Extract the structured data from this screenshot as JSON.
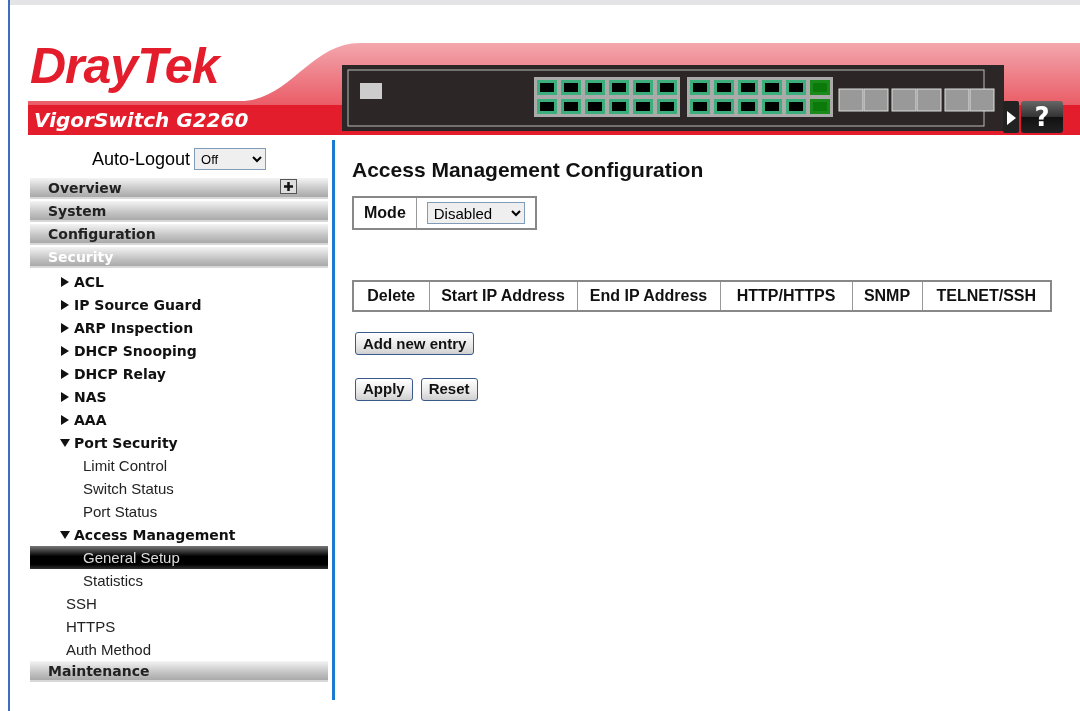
{
  "header": {
    "logo": "DrayTek",
    "model": "VigorSwitch G2260",
    "help_button": "?"
  },
  "sidebar": {
    "auto_logout": {
      "label": "Auto-Logout",
      "value": "Off"
    },
    "sections": [
      {
        "label": "Overview",
        "selected": false
      },
      {
        "label": "System",
        "selected": false
      },
      {
        "label": "Configuration",
        "selected": false
      },
      {
        "label": "Security",
        "selected": true,
        "children": [
          {
            "label": "ACL",
            "kind": "folder",
            "expanded": false,
            "selected": false
          },
          {
            "label": "IP Source Guard",
            "kind": "folder",
            "expanded": false,
            "selected": false
          },
          {
            "label": "ARP Inspection",
            "kind": "folder",
            "expanded": false,
            "selected": false
          },
          {
            "label": "DHCP Snooping",
            "kind": "folder",
            "expanded": false,
            "selected": false
          },
          {
            "label": "DHCP Relay",
            "kind": "folder",
            "expanded": false,
            "selected": false
          },
          {
            "label": "NAS",
            "kind": "folder",
            "expanded": false,
            "selected": false
          },
          {
            "label": "AAA",
            "kind": "folder",
            "expanded": false,
            "selected": false
          },
          {
            "label": "Port Security",
            "kind": "folder",
            "expanded": true,
            "selected": false,
            "children": [
              {
                "label": "Limit Control",
                "kind": "page",
                "selected": false
              },
              {
                "label": "Switch Status",
                "kind": "page",
                "selected": false
              },
              {
                "label": "Port Status",
                "kind": "page",
                "selected": false
              }
            ]
          },
          {
            "label": "Access Management",
            "kind": "folder",
            "expanded": true,
            "selected": false,
            "children": [
              {
                "label": "General Setup",
                "kind": "page",
                "selected": true
              },
              {
                "label": "Statistics",
                "kind": "page",
                "selected": false
              }
            ]
          },
          {
            "label": "SSH",
            "kind": "page",
            "selected": false
          },
          {
            "label": "HTTPS",
            "kind": "page",
            "selected": false
          },
          {
            "label": "Auth Method",
            "kind": "page",
            "selected": false
          }
        ]
      },
      {
        "label": "Maintenance",
        "selected": false
      }
    ]
  },
  "content": {
    "title": "Access Management Configuration",
    "mode": {
      "label": "Mode",
      "value": "Disabled"
    },
    "table": {
      "columns": [
        "Delete",
        "Start IP Address",
        "End IP Address",
        "HTTP/HTTPS",
        "SNMP",
        "TELNET/SSH"
      ]
    },
    "add_button": "Add new entry",
    "buttons": [
      "Apply",
      "Reset"
    ]
  }
}
